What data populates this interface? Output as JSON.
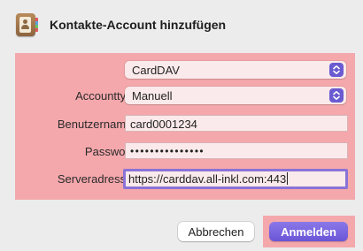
{
  "dialog": {
    "title": "Kontakte-Account hinzufügen",
    "app_icon": "contacts-app-icon"
  },
  "form": {
    "account_type_select": {
      "value": "CardDAV"
    },
    "accounttyp": {
      "label": "Accounttyp:",
      "value": "Manuell"
    },
    "benutzername": {
      "label": "Benutzername:",
      "value": "card0001234"
    },
    "passwort": {
      "label": "Passwort:",
      "value": "•••••••••••••••"
    },
    "serveradresse": {
      "label": "Serveradresse:",
      "value": "https://carddav.all-inkl.com:443"
    }
  },
  "buttons": {
    "cancel": "Abbrechen",
    "login": "Anmelden"
  },
  "colors": {
    "highlight": "#f5a8ac",
    "accent": "#6a55d6",
    "focus_ring": "#8a73d6"
  }
}
